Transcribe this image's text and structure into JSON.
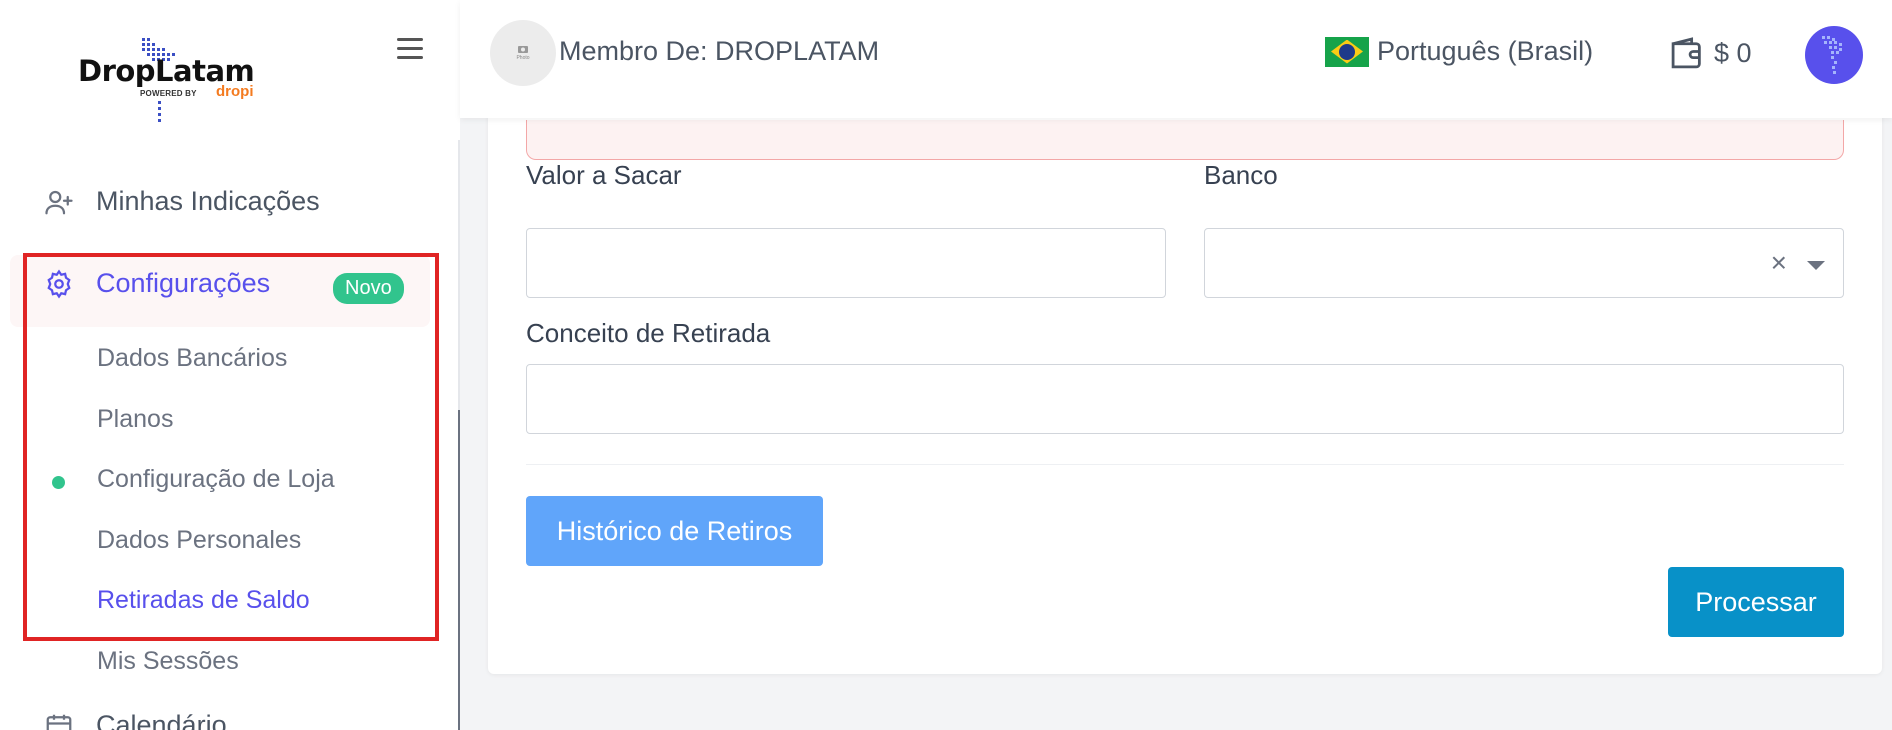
{
  "logo": {
    "brand": "DropLatam",
    "powered": "POWERED BY",
    "sub_brand": "dropi"
  },
  "sidebar": {
    "items": [
      {
        "label": "Minhas Indicações",
        "icon": "user-plus-icon"
      },
      {
        "label": "Configurações",
        "icon": "gear-icon",
        "badge": "Novo"
      },
      {
        "label": "Calendário",
        "icon": "calendar-icon"
      }
    ],
    "sub_items": [
      {
        "label": "Dados Bancários"
      },
      {
        "label": "Planos"
      },
      {
        "label": "Configuração de Loja"
      },
      {
        "label": "Dados Personales"
      },
      {
        "label": "Retiradas de Saldo"
      },
      {
        "label": "Mis Sessões"
      }
    ]
  },
  "topbar": {
    "avatar_small": "Photo\nNo Image",
    "member": "Membro De: DROPLATAM",
    "language": "Português (Brasil)",
    "balance": "$ 0"
  },
  "form": {
    "valor_label": "Valor a Sacar",
    "valor_value": "",
    "banco_label": "Banco",
    "banco_value": "",
    "conceito_label": "Conceito de Retirada",
    "conceito_value": "",
    "clear_symbol": "×",
    "historico_button": "Histórico de Retiros",
    "processar_button": "Processar"
  },
  "colors": {
    "accent": "#5850ec",
    "badge": "#31c48d",
    "highlight_border": "#e02424",
    "primary_button": "#0891c8",
    "secondary_button": "#60a5fa"
  }
}
